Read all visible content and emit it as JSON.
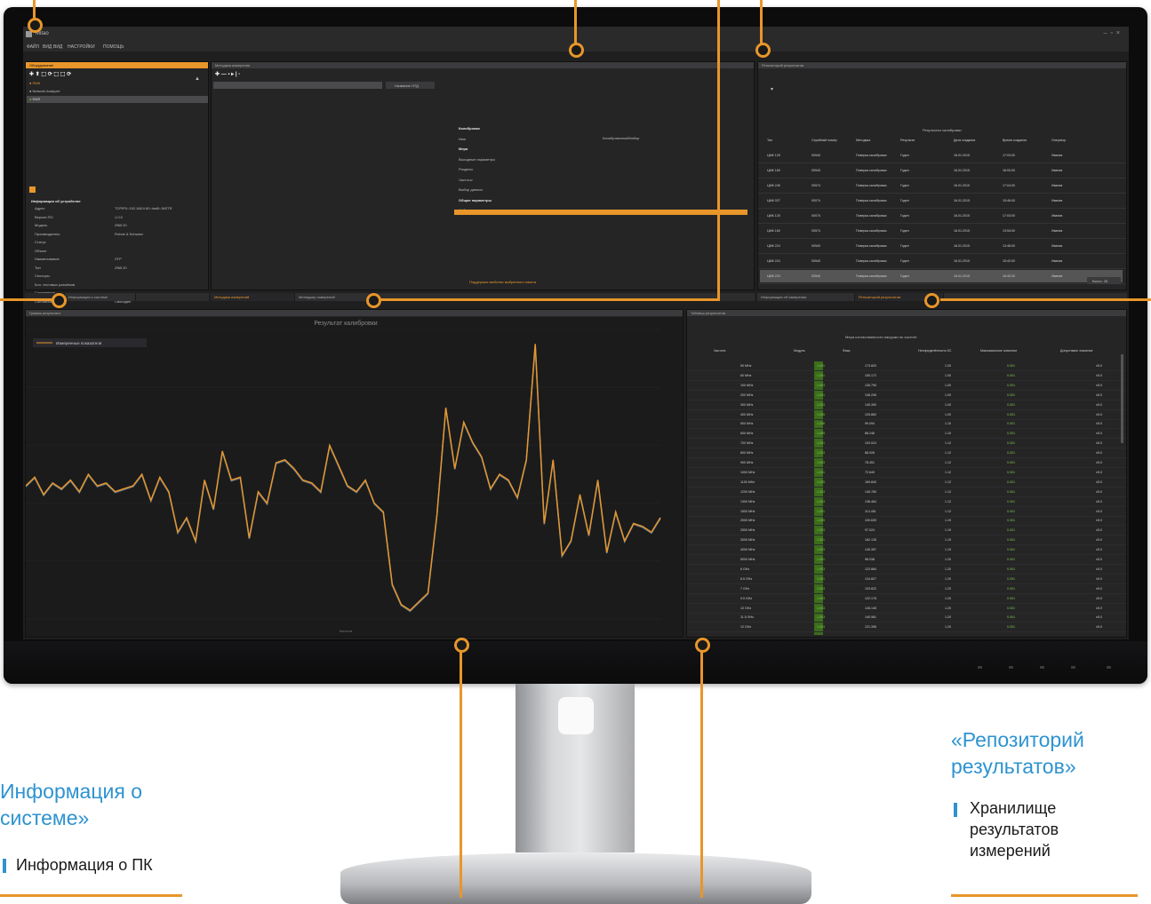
{
  "app": {
    "title": "Mitao",
    "menu": [
      "ФАЙЛ",
      "ВИД",
      "ВИД",
      "НАСТРОЙКИ",
      "ПОМОЩЬ"
    ]
  },
  "left_panel": {
    "header": "Оборудование",
    "devices": [
      "ПМК",
      "Network Analyzer",
      "ФИЛ"
    ],
    "props_title": "Информация об устройстве",
    "props": [
      [
        "Адрес",
        "TCPIP0::192.168.0.80::inst0::INSTR"
      ],
      [
        "Версия ПО",
        "1.0.0"
      ],
      [
        "Модель",
        "ZNB 20"
      ],
      [
        "Производитель",
        "Rohde & Schwarz"
      ],
      [
        "Статус",
        ""
      ],
      [
        "Объект",
        ""
      ],
      [
        "Наименование",
        "ЛТР"
      ],
      [
        "Тип",
        "ZNB 20"
      ],
      [
        "Сенсоры",
        ""
      ],
      [
        "Кол. тестовых разъёмов",
        ""
      ],
      [
        "Соединение",
        ""
      ],
      [
        "Состояние связи",
        "Свободен"
      ]
    ],
    "tabs": [
      "Информация о системе",
      "Оборудование"
    ]
  },
  "middle_panel": {
    "header": "Методики измерения",
    "search_label": "Название НТД",
    "tree": [
      "Калибровка",
      "Имя",
      "Мера",
      "Выходные параметры",
      "Разделы",
      "Частоты",
      "Выбор данных",
      "Общие параметры",
      "Набор параметров"
    ],
    "tree_value": "КалибровочныйНабор",
    "footer": "Поддержка свойство выбранного пакета",
    "tabs": [
      "Методики измерений",
      "Менеджер измерений"
    ]
  },
  "right_panel": {
    "header": "Репозиторий результатов",
    "table_title": "Результаты калибровки",
    "columns": [
      "Тип",
      "Серийный номер",
      "Методика",
      "Результат",
      "Дата создания",
      "Время создания",
      "Оператор"
    ],
    "rows": [
      [
        "ЦМК 125",
        "00540",
        "Поверка калибровка",
        "Годен",
        "16.01.2015",
        "17:03:00",
        "Иванов"
      ],
      [
        "ЦМК 160",
        "00540",
        "Поверка калибровка",
        "Годен",
        "16.01.2015",
        "16:00:00",
        "Иванов"
      ],
      [
        "ЦМК 245",
        "00574",
        "Поверка калибровка",
        "Годен",
        "16.01.2015",
        "17:04:00",
        "Иванов"
      ],
      [
        "ЦМК 027",
        "00074",
        "Поверка калибровка",
        "Годен",
        "16.01.2015",
        "15:46:00",
        "Иванов"
      ],
      [
        "ЦМК 125",
        "00074",
        "Поверка калибровка",
        "Годен",
        "16.01.2015",
        "17:03:00",
        "Иванов"
      ],
      [
        "ЦМК 160",
        "00574",
        "Поверка калибровка",
        "Годен",
        "16.01.2015",
        "13:54:00",
        "Иванов"
      ],
      [
        "ЦМК 224",
        "00540",
        "Поверка калибровка",
        "Годен",
        "16.01.2015",
        "13:46:00",
        "Иванов"
      ],
      [
        "ЦМК 224",
        "00540",
        "Поверка калибровка",
        "Годен",
        "16.01.2015",
        "15:42:00",
        "Иванов"
      ],
      [
        "ЦМК 224",
        "00540",
        "Поверка калибровка",
        "Годен",
        "16.01.2015",
        "15:42:00",
        "Иванов"
      ]
    ],
    "footer_btn": "Всего: 28",
    "tabs": [
      "Информация об измерении",
      "Репозиторий результатов"
    ]
  },
  "bottom_left": {
    "header": "График результата",
    "chart_title": "Результат калибровки",
    "legend": "Измеренные показатели",
    "xaxis_label": "Частота"
  },
  "bottom_right": {
    "header": "Таблица результатов",
    "title": "Мера согласованности нагрузки по частоте",
    "columns": [
      "Частота",
      "Модуль",
      "Фаза",
      "Неопределённость КС",
      "Максимальное значение",
      "Допустимое значение"
    ],
    "rows": [
      [
        "50 MHz",
        "1.001",
        "173.820",
        "1.00",
        "0.001",
        "±5.0"
      ],
      [
        "60 MHz",
        "1.001",
        "155.172",
        "1.00",
        "0.001",
        "±5.0"
      ],
      [
        "100 MHz",
        "1.003",
        "135.790",
        "1.00",
        "0.001",
        "±5.0"
      ],
      [
        "200 MHz",
        "1.001",
        "108.206",
        "1.00",
        "0.001",
        "±5.0"
      ],
      [
        "300 MHz",
        "1.003",
        "145.390",
        "1.00",
        "0.001",
        "±5.0"
      ],
      [
        "400 MHz",
        "1.005",
        "125.862",
        "1.00",
        "0.001",
        "±5.0"
      ],
      [
        "500 MHz",
        "1.006",
        "99.094",
        "1.10",
        "0.001",
        "±5.0"
      ],
      [
        "600 MHz",
        "1.005",
        "88.246",
        "1.10",
        "0.001",
        "±5.0"
      ],
      [
        "700 MHz",
        "1.001",
        "103.024",
        "1.12",
        "0.001",
        "±5.0"
      ],
      [
        "800 MHz",
        "1.003",
        "88.926",
        "1.12",
        "0.001",
        "±5.0"
      ],
      [
        "900 MHz",
        "1.003",
        "78.451",
        "1.12",
        "0.001",
        "±5.0"
      ],
      [
        "1000 MHz",
        "1.001",
        "72.649",
        "1.12",
        "0.001",
        "±5.0"
      ],
      [
        "1100 MHz",
        "1.005",
        "169.840",
        "1.12",
        "0.001",
        "±5.0"
      ],
      [
        "1200 MHz",
        "1.003",
        "145.780",
        "1.12",
        "0.001",
        "±5.0"
      ],
      [
        "1300 MHz",
        "1.003",
        "138.464",
        "1.12",
        "0.001",
        "±5.0"
      ],
      [
        "1500 MHz",
        "1.001",
        "114.451",
        "1.12",
        "0.001",
        "±5.0"
      ],
      [
        "2000 MHz",
        "1.005",
        "100.639",
        "1.19",
        "0.001",
        "±5.0"
      ],
      [
        "2500 MHz",
        "1.003",
        "97.024",
        "1.19",
        "0.001",
        "±5.0"
      ],
      [
        "3000 MHz",
        "1.001",
        "162.135",
        "1.19",
        "0.001",
        "±5.0"
      ],
      [
        "4000 MHz",
        "1.003",
        "145.357",
        "1.19",
        "0.001",
        "±5.0"
      ],
      [
        "5000 MHz",
        "1.001",
        "98.038",
        "1.20",
        "0.001",
        "±5.0"
      ],
      [
        "6 GHz",
        "1.003",
        "122.864",
        "1.20",
        "0.001",
        "±5.0"
      ],
      [
        "6.5 GHz",
        "1.001",
        "124.827",
        "1.20",
        "0.001",
        "±5.0"
      ],
      [
        "7 GHz",
        "1.003",
        "103.622",
        "1.20",
        "0.001",
        "±5.0"
      ],
      [
        "9.5 GHz",
        "1.003",
        "122.178",
        "1.20",
        "0.001",
        "±5.0"
      ],
      [
        "10 GHz",
        "1.003",
        "128.145",
        "1.20",
        "0.001",
        "±5.0"
      ],
      [
        "11.5 GHz",
        "1.003",
        "140.961",
        "1.20",
        "0.001",
        "±5.0"
      ],
      [
        "12 GHz",
        "1.003",
        "121.396",
        "1.20",
        "0.001",
        "±5.0"
      ]
    ]
  },
  "chart_data": {
    "type": "line",
    "title": "Результат калибровки",
    "xlabel": "Частота",
    "series": [
      {
        "name": "Измеренные показатели",
        "color": "#e8962a",
        "values": [
          46,
          49,
          43,
          47,
          45,
          48,
          44,
          50,
          46,
          47,
          44,
          45,
          46,
          50,
          41,
          49,
          44,
          30,
          35,
          27,
          48,
          38,
          58,
          48,
          49,
          28,
          44,
          40,
          54,
          55,
          52,
          48,
          47,
          44,
          60,
          53,
          46,
          44,
          48,
          40,
          37,
          12,
          5,
          3,
          6,
          9,
          36,
          73,
          52,
          68,
          61,
          56,
          45,
          50,
          48,
          42,
          55,
          95,
          33,
          55,
          22,
          27,
          43,
          29,
          48,
          23,
          37,
          27,
          33,
          32,
          30,
          35
        ]
      }
    ],
    "ylim": [
      0,
      100
    ]
  },
  "callouts": {
    "left_title": "Информация о системе»",
    "left_desc": "Информация о ПК",
    "right_title": "«Репозиторий результатов»",
    "right_desc": "Хранилище результатов измерений"
  }
}
